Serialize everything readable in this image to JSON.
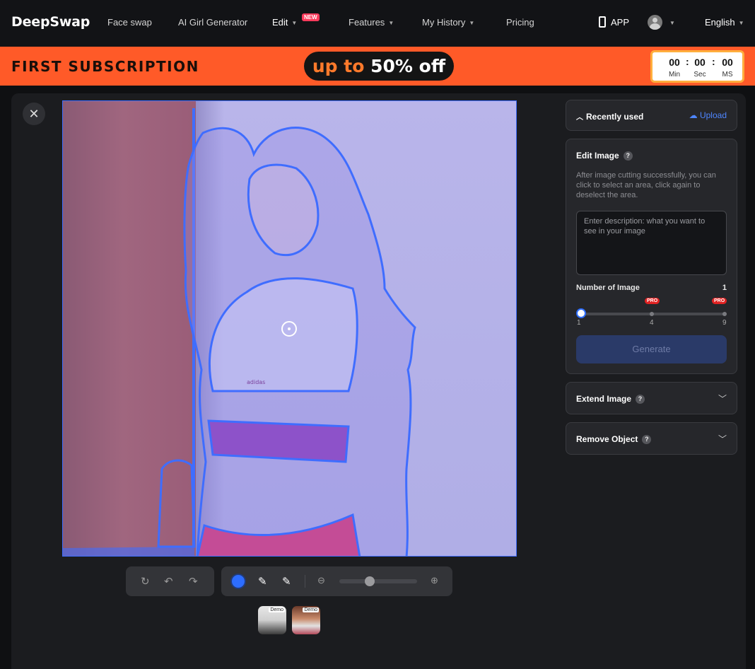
{
  "nav": {
    "logo": "DeepSwap",
    "items": {
      "face_swap": "Face swap",
      "ai_girl": "AI Girl Generator",
      "edit": "Edit",
      "edit_badge": "NEW",
      "features": "Features",
      "history": "My History",
      "pricing": "Pricing",
      "app": "APP",
      "language": "English"
    }
  },
  "promo": {
    "title": "FIRST SUBSCRIPTION",
    "offer_prefix": "up to",
    "offer_value": "50% off",
    "timer": {
      "min": "00",
      "sec": "00",
      "ms": "00",
      "min_label": "Min",
      "sec_label": "Sec",
      "ms_label": "MS"
    }
  },
  "editor": {
    "demo_tag": "Demo"
  },
  "sidebar": {
    "recently_used": "Recently used",
    "upload": "Upload",
    "edit_image": {
      "title": "Edit Image",
      "hint": "After image cutting successfully, you can click to select an area, click again to deselect the area.",
      "placeholder": "Enter description: what you want to see in your image",
      "number_label": "Number of Image",
      "number_value": "1",
      "pro_badge": "PRO",
      "ticks": [
        "1",
        "4",
        "9"
      ],
      "generate": "Generate"
    },
    "extend_image": "Extend Image",
    "remove_object": "Remove Object",
    "help_glyph": "?"
  },
  "icons": {
    "close": "close-icon",
    "phone": "phone-icon",
    "avatar": "avatar",
    "reset": "reset-icon",
    "undo": "undo-icon",
    "redo": "redo-icon",
    "brush_add": "brush-add-icon",
    "brush_erase": "brush-erase-icon",
    "zoom_out": "zoom-out-icon",
    "zoom_in": "zoom-in-icon",
    "upload": "cloud-upload-icon",
    "chevron": "chevron-down-icon"
  },
  "colors": {
    "accent": "#2d6dff",
    "promo_bg": "#ff5a28",
    "mask": "#3f6dff",
    "pro": "#e02222"
  }
}
